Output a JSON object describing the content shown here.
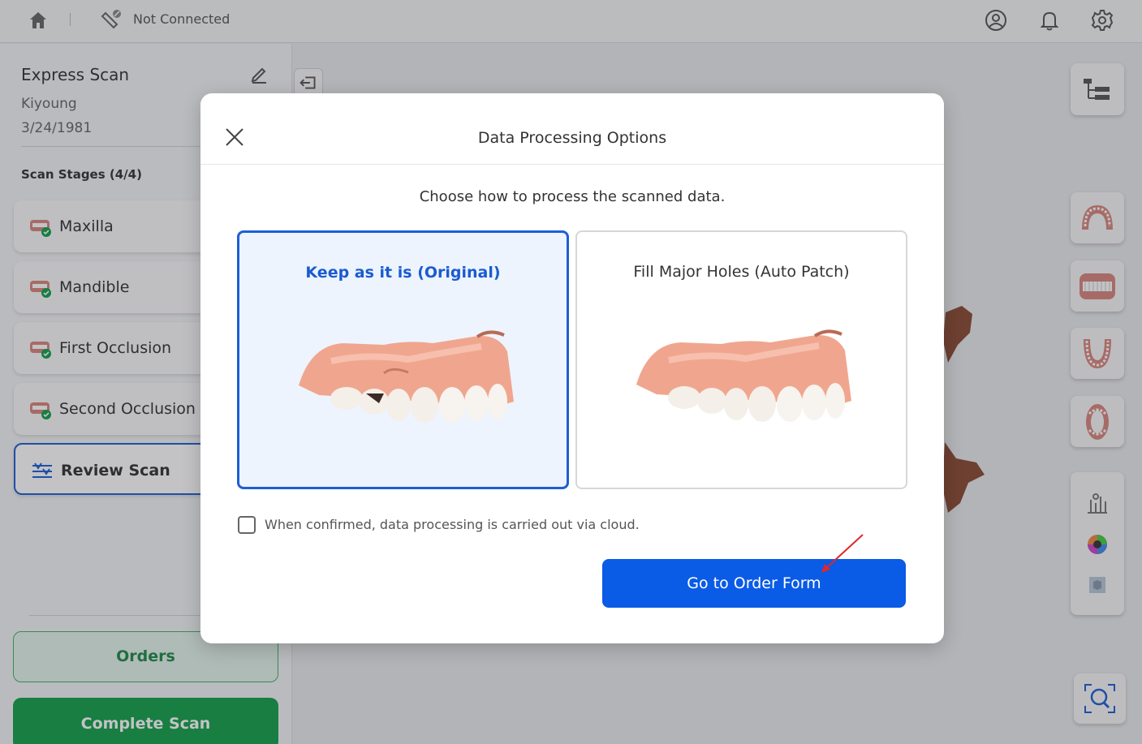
{
  "topbar": {
    "connection_status": "Not Connected",
    "icons": [
      "home-icon",
      "scanner-icon",
      "account-icon",
      "bell-icon",
      "gear-icon"
    ]
  },
  "case": {
    "title": "Express Scan",
    "patient_name": "Kiyoung",
    "dob": "3/24/1981"
  },
  "stages": {
    "heading": "Scan Stages (4/4)",
    "items": [
      {
        "label": "Maxilla",
        "done": true
      },
      {
        "label": "Mandible",
        "done": true
      },
      {
        "label": "First Occlusion",
        "done": true
      },
      {
        "label": "Second Occlusion",
        "done": true
      },
      {
        "label": "Review Scan",
        "active": true
      }
    ]
  },
  "buttons": {
    "orders": "Orders",
    "complete_scan": "Complete Scan"
  },
  "modal": {
    "title": "Data Processing Options",
    "subtitle": "Choose how to process the scanned data.",
    "options": [
      {
        "label": "Keep as it is (Original)",
        "selected": true
      },
      {
        "label": "Fill Major Holes (Auto Patch)",
        "selected": false
      }
    ],
    "cloud_checkbox_label": "When confirmed, data processing is carried out via cloud.",
    "cloud_checked": false,
    "primary_button": "Go to Order Form"
  },
  "colors": {
    "accent_blue": "#0a5be6",
    "selected_border": "#1d5fd6",
    "green": "#12a04a",
    "annotation_arrow": "#e0262b"
  }
}
